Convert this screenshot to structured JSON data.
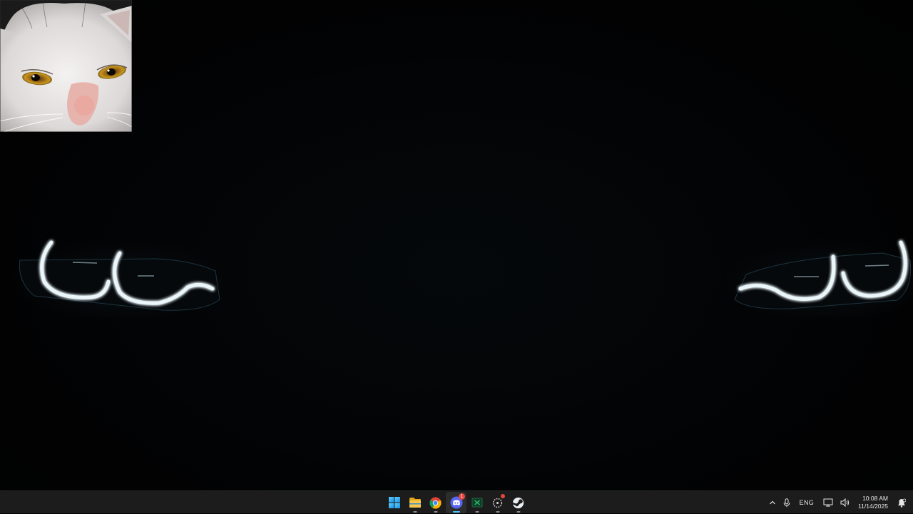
{
  "desktop": {
    "wallpaper": "dark-car-headlights",
    "overlay_image": "cat-face"
  },
  "taskbar": {
    "pinned": [
      {
        "name": "start",
        "icon": "windows-logo-icon",
        "label": "Start"
      },
      {
        "name": "file-explorer",
        "icon": "folder-icon",
        "label": "File Explorer"
      },
      {
        "name": "chrome",
        "icon": "chrome-icon",
        "label": "Google Chrome"
      },
      {
        "name": "discord",
        "icon": "discord-icon",
        "label": "Discord",
        "badge": "1"
      },
      {
        "name": "excel",
        "icon": "excel-icon",
        "label": "Excel"
      },
      {
        "name": "app-dotted",
        "icon": "dotted-circle-icon",
        "label": "App"
      },
      {
        "name": "steam",
        "icon": "steam-icon",
        "label": "Steam"
      }
    ],
    "tray": {
      "overflow_icon": "chevron-up-icon",
      "mic_icon": "microphone-icon",
      "language": "ENG",
      "network_icon": "network-icon",
      "volume_icon": "speaker-icon",
      "time": "10:08 AM",
      "date": "11/14/2025",
      "notification_icon": "notification-bell-icon"
    }
  },
  "colors": {
    "taskbar_bg": "#1c1c1c",
    "accent": "#4cc2ff",
    "headlight_glow": "#e8f4f8"
  }
}
